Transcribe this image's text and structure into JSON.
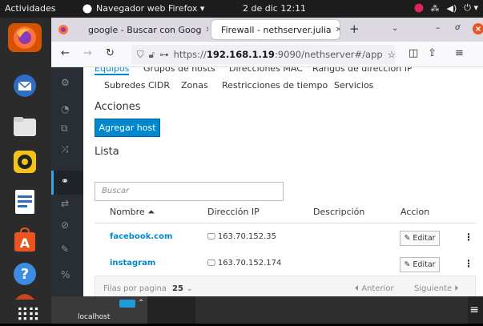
{
  "topbar": {
    "activities": "Actividades",
    "app_name": "Navegador web Firefox ▾",
    "clock": "2 de dic  12:11"
  },
  "browser": {
    "tabs": [
      {
        "label": "google - Buscar con Goog"
      },
      {
        "label": "Firewall - nethserver.julia"
      }
    ],
    "url_prefix": "https://",
    "url_host": "192.168.1.19",
    "url_rest": ":9090/nethserver#/app"
  },
  "page": {
    "tabs_row1": [
      "Equipos",
      "Grupos de hosts",
      "Direcciones MAC",
      "Rangos de dirección IP"
    ],
    "tabs_row2": [
      "Subredes CIDR",
      "Zonas",
      "Restricciones de tiempo",
      "Servicios"
    ],
    "actions_title": "Acciones",
    "add_host_label": "Agregar host",
    "list_title": "Lista",
    "search_placeholder": "Buscar",
    "columns": {
      "name": "Nombre ⏶",
      "ip": "Dirección IP",
      "desc": "Descripción",
      "action": "Accion"
    },
    "rows": [
      {
        "name": "facebook.com",
        "ip": "163.70.152.35",
        "desc": "",
        "edit": "Editar"
      },
      {
        "name": "instagram",
        "ip": "163.70.152.174",
        "desc": "",
        "edit": "Editar"
      }
    ],
    "pager": {
      "label": "Filas por pagina",
      "value": "25",
      "prev": "Anterior",
      "next": "Siguiente"
    }
  },
  "taskbar": {
    "host": "localhost"
  },
  "colors": {
    "primary": "#0088ce",
    "sidebar": "#292e34",
    "ubuntu_orange": "#e95420"
  }
}
